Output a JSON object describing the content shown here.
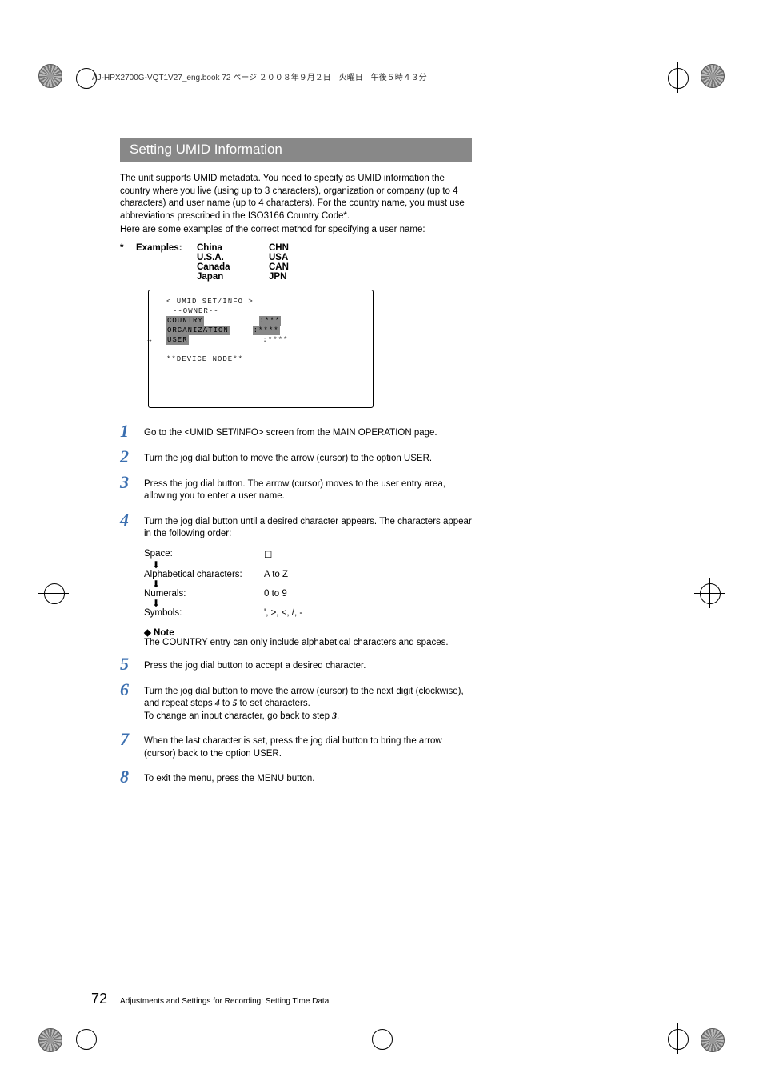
{
  "print_header": "AJ-HPX2700G-VQT1V27_eng.book  72 ページ  ２００８年９月２日　火曜日　午後５時４３分",
  "heading": "Setting UMID Information",
  "intro": "The unit supports UMID metadata. You need to specify as UMID information the country where you live (using up to 3 characters), organization or company (up to 4 characters) and user name (up to 4 characters). For the country name, you must use abbreviations prescribed in the ISO3166 Country Code*.",
  "intro_tail": "Here are some examples of the correct method for specifying a user name:",
  "examples": {
    "marker": "*",
    "label": "Examples:",
    "rows": [
      {
        "name": "China",
        "code": "CHN"
      },
      {
        "name": "U.S.A.",
        "code": "USA"
      },
      {
        "name": "Canada",
        "code": "CAN"
      },
      {
        "name": "Japan",
        "code": "JPN"
      }
    ]
  },
  "screen": {
    "title": "< UMID SET/INFO >",
    "owner": "--OWNER--",
    "lines": [
      {
        "label": "COUNTRY",
        "value": ":***",
        "hl": true,
        "arrow": false
      },
      {
        "label": "ORGANIZATION",
        "value": ":****",
        "hl": true,
        "arrow": false
      },
      {
        "label": "USER",
        "value": ":****",
        "hl": true,
        "arrow": true
      }
    ],
    "device": "**DEVICE NODE**"
  },
  "steps": {
    "s1": "Go to the <UMID SET/INFO> screen from the MAIN OPERATION page.",
    "s2": "Turn the jog dial button to move the arrow (cursor) to the option USER.",
    "s3": "Press the jog dial button. The arrow (cursor) moves to the user entry area, allowing you to enter a user name.",
    "s4": "Turn the jog dial button until a desired character appears. The characters appear in the following order:",
    "s5": "Press the jog dial button to accept a desired character.",
    "s6_a": "Turn the jog dial button to move the arrow (cursor) to the next digit (clockwise), and repeat steps ",
    "s6_ref1": "4",
    "s6_mid": " to ",
    "s6_ref2": "5",
    "s6_b": " to set characters.",
    "s6_c": "To change an input character, go back to step ",
    "s6_ref3": "3",
    "s6_d": ".",
    "s7": "When the last character is set, press the jog dial button to bring the arrow (cursor) back to the option USER.",
    "s8": "To exit the menu, press the MENU button."
  },
  "char_table": {
    "space": {
      "label": "Space:",
      "value": "☐"
    },
    "alpha": {
      "label": "Alphabetical characters:",
      "value": "A to Z"
    },
    "num": {
      "label": "Numerals:",
      "value": "0 to 9"
    },
    "sym": {
      "label": "Symbols:",
      "value": "', >, <, /, -"
    }
  },
  "note": {
    "title": "◆ Note",
    "body": "The COUNTRY entry can only include alphabetical characters and spaces."
  },
  "footer": {
    "page": "72",
    "path": "Adjustments and Settings for Recording: Setting Time Data"
  }
}
